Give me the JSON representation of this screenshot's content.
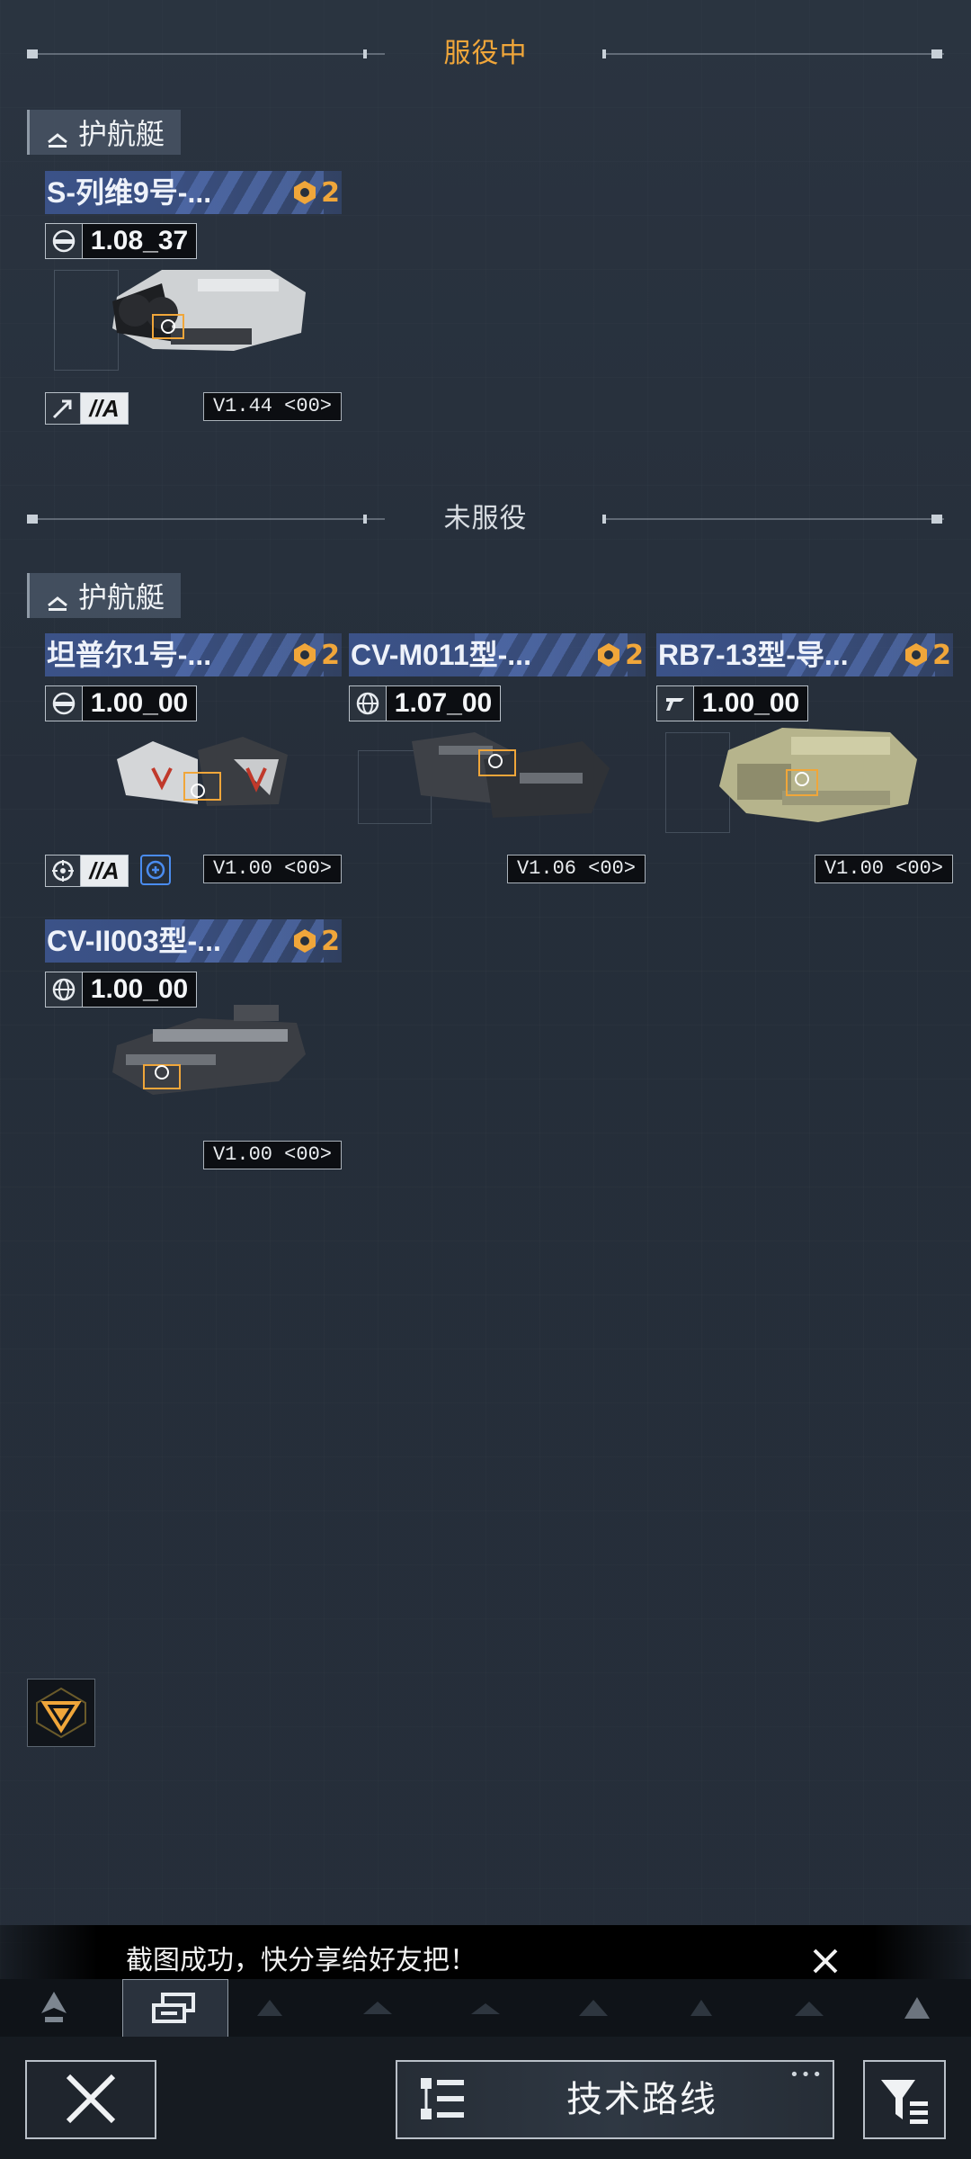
{
  "sections": {
    "in_service": {
      "title": "服役中",
      "color": "#f0a63a"
    },
    "not_in_service": {
      "title": "未服役",
      "color": "#d8dde2"
    }
  },
  "category_label": "护航艇",
  "cards": [
    {
      "name": "S-列维9号-...",
      "level": "2",
      "power": "1.08_37",
      "power_icon": "radar-icon",
      "type_grade": "//A",
      "type_icon": "assault-icon",
      "version": "V1.44 <00>"
    },
    {
      "name": "坦普尔1号-...",
      "level": "2",
      "power": "1.00_00",
      "power_icon": "radar-icon",
      "type_grade": "//A",
      "type_icon": "target-icon",
      "version": "V1.00 <00>",
      "extra_icon": "support-icon"
    },
    {
      "name": "CV-M011型-...",
      "level": "2",
      "power": "1.07_00",
      "power_icon": "globe-icon",
      "version": "V1.06 <00>"
    },
    {
      "name": "RB7-13型-导...",
      "level": "2",
      "power": "1.00_00",
      "power_icon": "manufacturer-icon",
      "version": "V1.00 <00>"
    },
    {
      "name": "CV-II003型-...",
      "level": "2",
      "power": "1.00_00",
      "power_icon": "globe-icon",
      "version": "V1.00 <00>"
    }
  ],
  "toast": {
    "message": "截图成功，快分享给好友把！"
  },
  "bottom_bar": {
    "tech_label": "技术路线",
    "dots": "•••"
  },
  "colors": {
    "accent": "#f0a63a",
    "name_bar": "#3b5288",
    "background": "#27303c"
  }
}
